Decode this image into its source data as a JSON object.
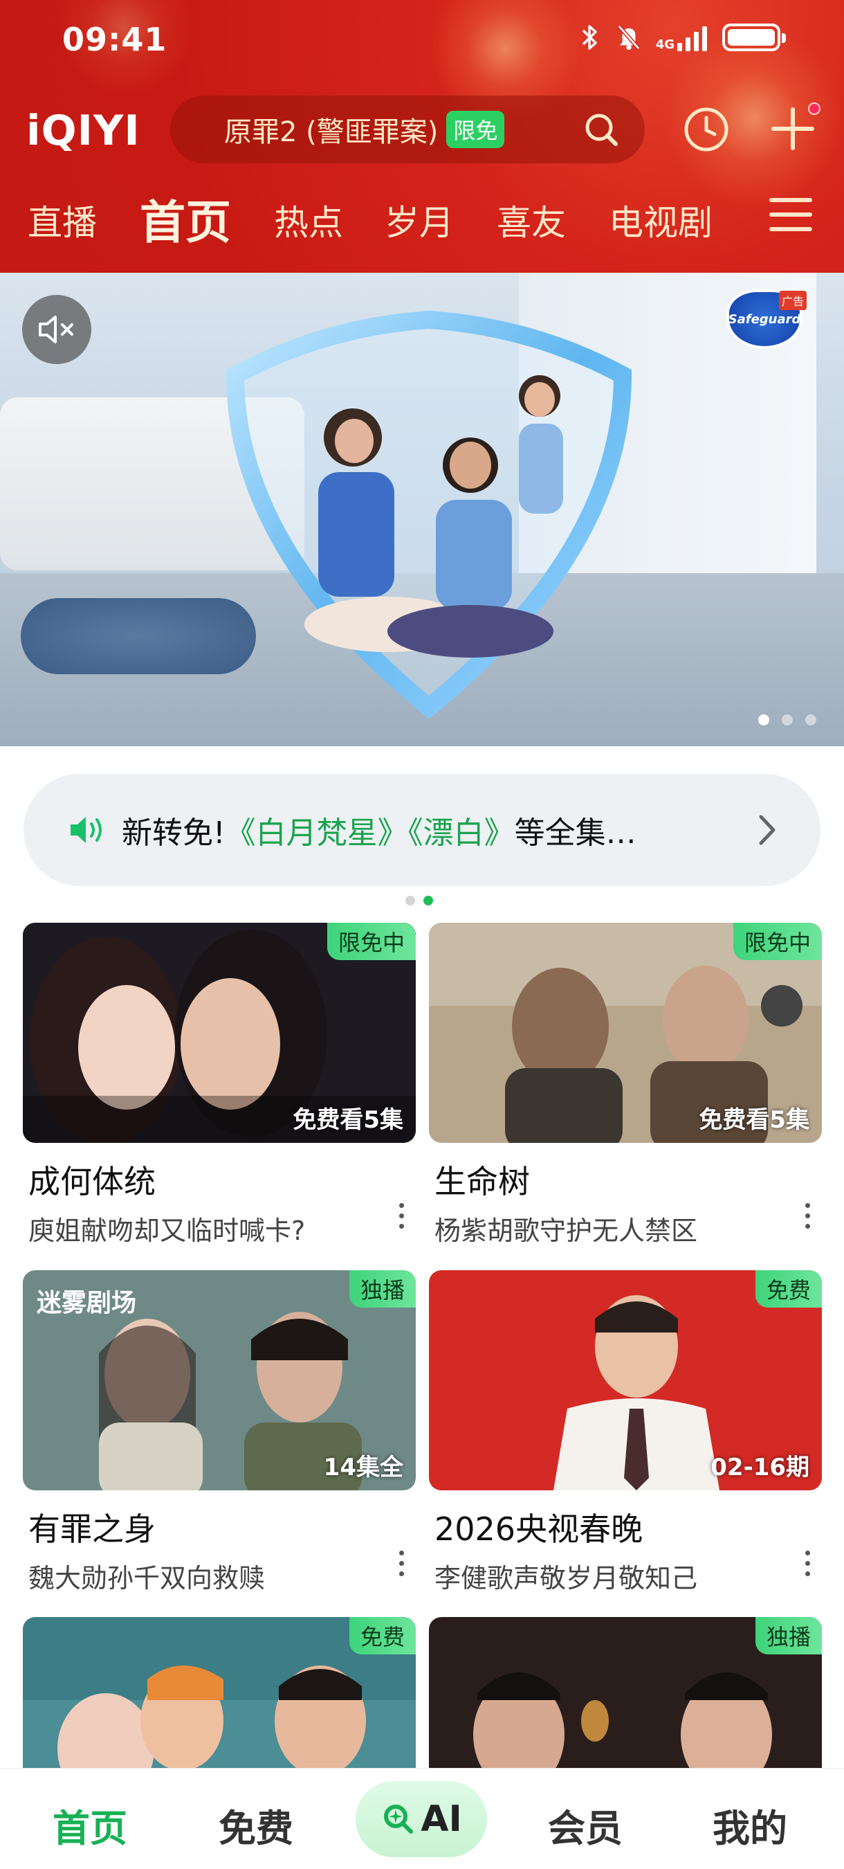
{
  "status_bar": {
    "time": "09:41",
    "network": "4G",
    "icons": [
      "bluetooth-icon",
      "mute-bell-icon",
      "signal-icon",
      "battery-icon"
    ]
  },
  "header": {
    "logo": "iQIYI",
    "search": {
      "text": "原罪2 (警匪罪案)",
      "badge": "限免"
    },
    "icons": [
      "search-icon",
      "history-clock-icon",
      "add-plus-icon",
      "menu-icon"
    ]
  },
  "nav": {
    "tabs": [
      "直播",
      "首页",
      "热点",
      "岁月",
      "喜友",
      "电视剧"
    ],
    "active": "首页"
  },
  "banner": {
    "brand_tag": "广告",
    "brand_name": "Safeguard",
    "dots": 3,
    "active_dot": 1
  },
  "notice": {
    "prefix": "新转免!",
    "title1": "《白月梵星》",
    "title2": "《漂白》",
    "suffix": "等全集…"
  },
  "cards": [
    {
      "tag": "限免中",
      "count": "免费看5集",
      "title": "成何体统",
      "subtitle": "庾姐献吻却又临时喊卡?"
    },
    {
      "tag": "限免中",
      "count": "免费看5集",
      "title": "生命树",
      "subtitle": "杨紫胡歌守护无人禁区"
    },
    {
      "tag": "独播",
      "count": "14集全",
      "title": "有罪之身",
      "subtitle": "魏大勋孙千双向救赎",
      "overlay": "迷雾剧场"
    },
    {
      "tag": "免费",
      "count": "02-16期",
      "title": "2026央视春晚",
      "subtitle": "李健歌声敬岁月敬知己"
    },
    {
      "tag": "免费"
    },
    {
      "tag": "独播"
    }
  ],
  "bottom_nav": {
    "items": [
      "首页",
      "免费",
      "AI",
      "会员",
      "我的"
    ],
    "active": "首页"
  },
  "colors": {
    "header_red": "#c81a14",
    "accent_green": "#18b155",
    "badge_green": "#2bd062"
  }
}
